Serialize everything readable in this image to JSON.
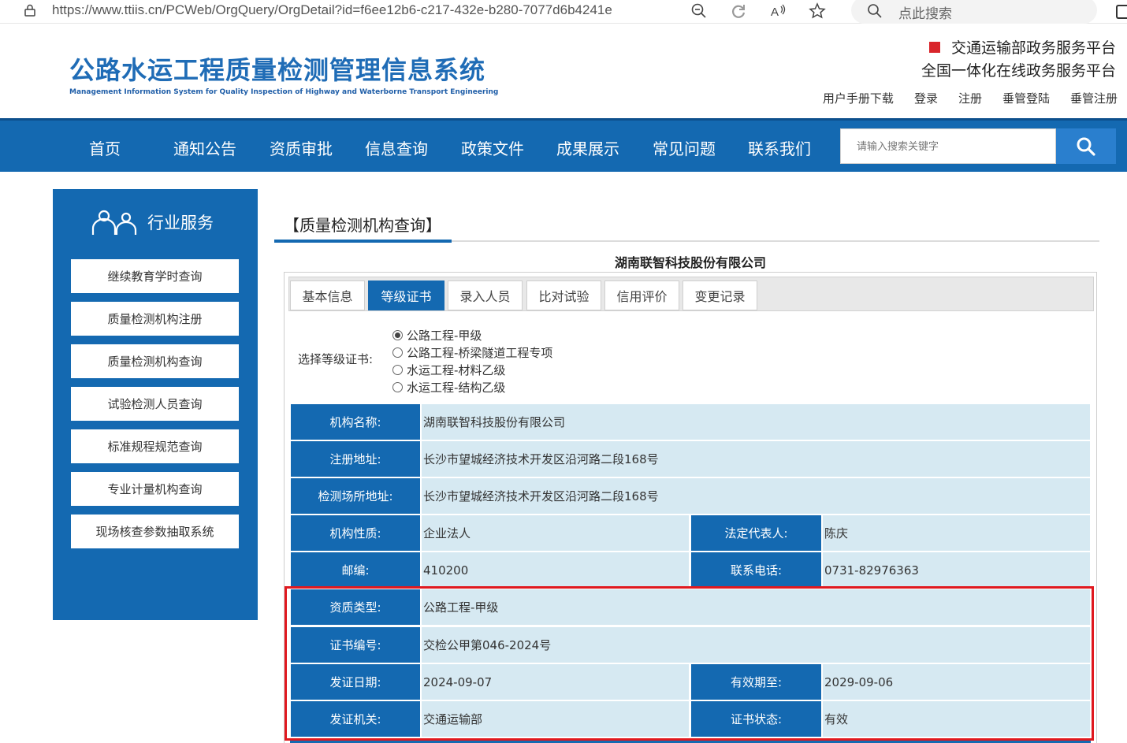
{
  "browser": {
    "url": "https://www.ttiis.cn/PCWeb/OrgQuery/OrgDetail?id=f6ee12b6-c217-432e-b280-7077d6b4241e",
    "search_placeholder": "点此搜索"
  },
  "header": {
    "title": "公路水运工程质量检测管理信息系统",
    "subtitle": "Management Information System for Quality Inspection of Highway and Waterborne Transport Engineering",
    "gov_platform_1": "交通运输部政务服务平台",
    "gov_platform_2": "全国一体化在线政务服务平台",
    "links": [
      "用户手册下载",
      "登录",
      "注册",
      "垂管登陆",
      "垂管注册"
    ]
  },
  "nav": {
    "items": [
      "首页",
      "通知公告",
      "资质审批",
      "信息查询",
      "政策文件",
      "成果展示",
      "常见问题",
      "联系我们"
    ],
    "search_placeholder": "请输入搜索关键字"
  },
  "sidebar": {
    "heading": "行业服务",
    "items": [
      "继续教育学时查询",
      "质量检测机构注册",
      "质量检测机构查询",
      "试验检测人员查询",
      "标准规程规范查询",
      "专业计量机构查询",
      "现场核查参数抽取系统"
    ]
  },
  "main": {
    "title": "【质量检测机构查询】",
    "org_name": "湖南联智科技股份有限公司",
    "tabs": [
      "基本信息",
      "等级证书",
      "录入人员",
      "比对试验",
      "信用评价",
      "变更记录"
    ],
    "active_tab": "等级证书",
    "cert_select_label": "选择等级证书:",
    "cert_options": [
      "公路工程-甲级",
      "公路工程-桥梁隧道工程专项",
      "水运工程-材料乙级",
      "水运工程-结构乙级"
    ],
    "cert_selected": "公路工程-甲级"
  },
  "details": {
    "org_name_label": "机构名称:",
    "org_name_value": "湖南联智科技股份有限公司",
    "reg_addr_label": "注册地址:",
    "reg_addr_value": "长沙市望城经济技术开发区沿河路二段168号",
    "site_addr_label": "检测场所地址:",
    "site_addr_value": "长沙市望城经济技术开发区沿河路二段168号",
    "nature_label": "机构性质:",
    "nature_value": "企业法人",
    "legal_rep_label": "法定代表人:",
    "legal_rep_value": "陈庆",
    "postcode_label": "邮编:",
    "postcode_value": "410200",
    "phone_label": "联系电话:",
    "phone_value": "0731-82976363",
    "qual_type_label": "资质类型:",
    "qual_type_value": "公路工程-甲级",
    "cert_no_label": "证书编号:",
    "cert_no_value": "交检公甲第046-2024号",
    "issue_date_label": "发证日期:",
    "issue_date_value": "2024-09-07",
    "valid_until_label": "有效期至:",
    "valid_until_value": "2029-09-06",
    "issuer_label": "发证机关:",
    "issuer_value": "交通运输部",
    "cert_status_label": "证书状态:",
    "cert_status_value": "有效"
  },
  "colors": {
    "primary_blue": "#1469b1",
    "cell_light": "#d6e9f2",
    "highlight_red": "#e0191f"
  }
}
